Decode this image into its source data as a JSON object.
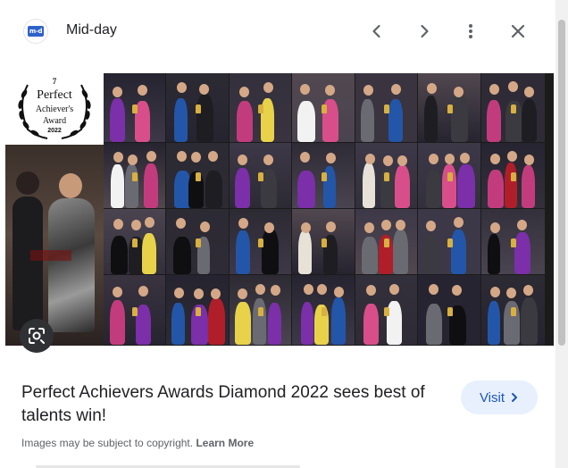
{
  "header": {
    "logo_text": "m-d",
    "site_name": "Mid-day",
    "buttons": {
      "previous_icon": "chevron-left-icon",
      "next_icon": "chevron-right-icon",
      "more_icon": "more-vert-icon",
      "close_icon": "close-icon"
    }
  },
  "image": {
    "award_logo": {
      "edition": "7",
      "line1": "Perfect",
      "line2": "Achiever's",
      "line3": "Award",
      "year": "2022"
    },
    "lens_icon": "lens-search-icon"
  },
  "result": {
    "title": "Perfect Achievers Awards Diamond 2022 sees best of talents win!",
    "visit_label": "Visit",
    "visit_icon": "chevron-right-icon",
    "copyright_text": "Images may be subject to copyright.",
    "learn_more_label": "Learn More"
  },
  "colors": {
    "accent": "#1a56b8",
    "visit_bg": "#e8f0fe",
    "logo_blue": "#2f62c9",
    "logo_red": "#e3262d"
  }
}
